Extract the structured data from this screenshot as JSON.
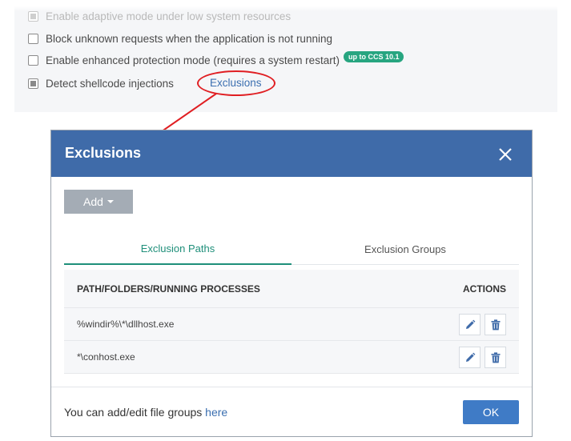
{
  "settings": {
    "options": [
      {
        "label": "Enable adaptive mode under low system resources",
        "checked": true,
        "faded": true
      },
      {
        "label": "Block unknown requests when the application is not running",
        "checked": false
      },
      {
        "label": "Enable enhanced protection mode (requires a system restart)",
        "checked": false,
        "badge": "up to CCS 10.1"
      },
      {
        "label": "Detect shellcode injections",
        "checked": true
      }
    ],
    "exclusions_link": "Exclusions",
    "callout_color": "#e01e22"
  },
  "dialog": {
    "title": "Exclusions",
    "header_color": "#3f6ba9",
    "close_icon": "close-icon",
    "add_button": "Add",
    "tabs": [
      {
        "label": "Exclusion Paths",
        "active": true
      },
      {
        "label": "Exclusion Groups",
        "active": false
      }
    ],
    "table": {
      "columns": [
        "PATH/FOLDERS/RUNNING PROCESSES",
        "ACTIONS"
      ],
      "rows": [
        {
          "path": "%windir%\\*\\dllhost.exe",
          "actions": [
            "pencil-icon",
            "trash-icon"
          ]
        },
        {
          "path": "*\\conhost.exe",
          "actions": [
            "pencil-icon",
            "trash-icon"
          ]
        }
      ]
    },
    "footer": {
      "text": "You can add/edit file groups ",
      "link": "here",
      "ok_button": "OK"
    }
  }
}
